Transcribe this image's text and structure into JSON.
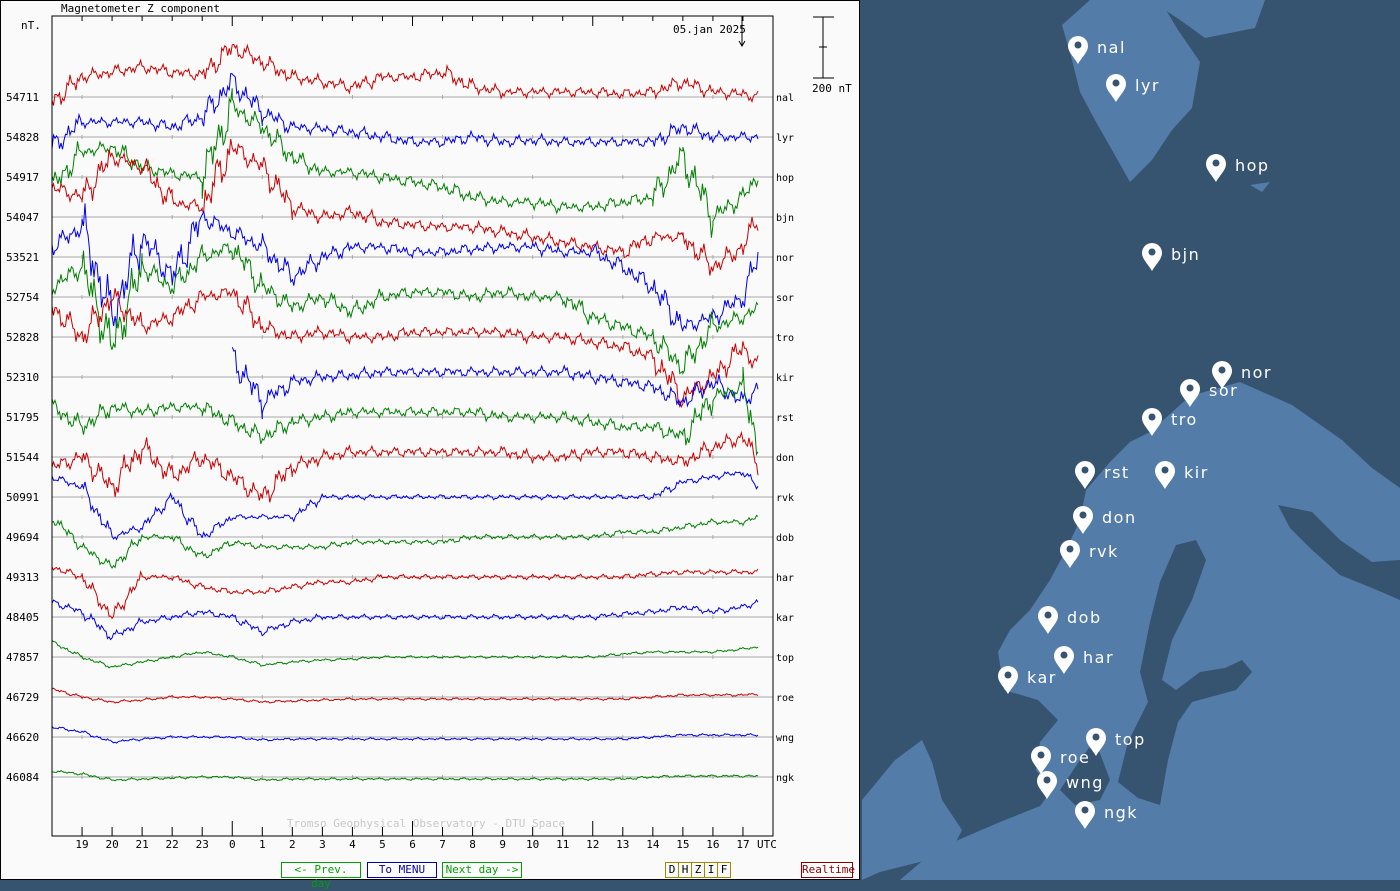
{
  "chart_data": {
    "type": "line",
    "title": "Magnetometer Z component",
    "ylabel": "nT.",
    "date_label": "05.jan 2025",
    "scale_label": "200 nT",
    "scale_nT": 200,
    "watermark": "Tromso Geophysical Observatory - DTU Space",
    "x_unit": "UTC",
    "x_range_hours": [
      18,
      42
    ],
    "x_tick_labels": [
      "19",
      "20",
      "21",
      "22",
      "23",
      "0",
      "1",
      "2",
      "3",
      "4",
      "5",
      "6",
      "7",
      "8",
      "9",
      "10",
      "11",
      "12",
      "13",
      "14",
      "15",
      "16",
      "17"
    ],
    "x": [
      18,
      19,
      20,
      21,
      22,
      23,
      24,
      25,
      26,
      27,
      28,
      29,
      30,
      31,
      32,
      33,
      34,
      35,
      36,
      37,
      38,
      39,
      40,
      41,
      41.5
    ],
    "series": [
      {
        "name": "nal",
        "baseline": "54711",
        "color": "#cc0000",
        "values": [
          -15,
          60,
          75,
          90,
          75,
          66,
          150,
          105,
          60,
          45,
          30,
          60,
          60,
          75,
          30,
          15,
          15,
          15,
          15,
          9,
          15,
          45,
          15,
          9,
          0
        ]
      },
      {
        "name": "lyr",
        "baseline": "54828",
        "color": "#0000ee",
        "values": [
          -30,
          45,
          45,
          45,
          30,
          60,
          165,
          75,
          30,
          24,
          15,
          0,
          -15,
          -15,
          0,
          -15,
          -9,
          -15,
          -15,
          -15,
          -15,
          30,
          0,
          0,
          0
        ]
      },
      {
        "name": "hop",
        "baseline": "54917",
        "color": "#008000",
        "values": [
          -30,
          75,
          90,
          30,
          9,
          0,
          210,
          150,
          60,
          15,
          15,
          0,
          -15,
          -30,
          -60,
          -75,
          -75,
          -90,
          -90,
          -75,
          -60,
          60,
          -120,
          -60,
          0
        ]
      },
      {
        "name": "bjn",
        "baseline": "54047",
        "color": "#cc0000",
        "values": [
          90,
          60,
          180,
          150,
          45,
          30,
          210,
          150,
          30,
          0,
          15,
          -15,
          -24,
          -30,
          -30,
          -45,
          -60,
          -75,
          -90,
          -105,
          -60,
          -60,
          -150,
          -90,
          0
        ]
      },
      {
        "name": "nor",
        "baseline": "53521",
        "color": "#0000ee",
        "values": [
          30,
          90,
          -180,
          60,
          -60,
          120,
          75,
          30,
          -60,
          0,
          30,
          30,
          15,
          15,
          24,
          30,
          30,
          15,
          15,
          -30,
          -90,
          -210,
          -180,
          -120,
          0
        ]
      },
      {
        "name": "sor",
        "baseline": "52754",
        "color": "#008000",
        "values": [
          30,
          90,
          -150,
          90,
          30,
          120,
          150,
          30,
          -30,
          0,
          -45,
          0,
          15,
          15,
          0,
          15,
          0,
          0,
          -60,
          -90,
          -120,
          -210,
          -90,
          -60,
          -30
        ]
      },
      {
        "name": "tro",
        "baseline": "52828",
        "color": "#cc0000",
        "values": [
          90,
          0,
          120,
          30,
          60,
          120,
          135,
          30,
          0,
          15,
          0,
          0,
          15,
          15,
          15,
          15,
          0,
          0,
          -15,
          -30,
          -60,
          -180,
          -120,
          -30,
          -90
        ]
      },
      {
        "name": "kir",
        "baseline": "52310",
        "color": "#0000ee",
        "values": [
          null,
          null,
          null,
          null,
          null,
          null,
          60,
          -75,
          -15,
          0,
          6,
          15,
          15,
          15,
          15,
          15,
          15,
          15,
          0,
          -15,
          -30,
          -75,
          -15,
          -75,
          -30
        ]
      },
      {
        "name": "rst",
        "baseline": "51795",
        "color": "#008000",
        "values": [
          30,
          -30,
          30,
          15,
          30,
          30,
          -15,
          -60,
          -15,
          0,
          15,
          15,
          15,
          15,
          15,
          0,
          0,
          0,
          -15,
          -30,
          -30,
          -60,
          60,
          90,
          -90
        ]
      },
      {
        "name": "don",
        "baseline": "51544",
        "color": "#cc0000",
        "values": [
          -30,
          0,
          -90,
          30,
          -60,
          0,
          -60,
          -120,
          -30,
          0,
          15,
          15,
          15,
          15,
          15,
          15,
          0,
          0,
          15,
          15,
          0,
          -15,
          30,
          60,
          -15
        ]
      },
      {
        "name": "rvk",
        "baseline": "50991",
        "color": "#0000ee",
        "values": [
          60,
          30,
          -120,
          -90,
          0,
          -120,
          -60,
          -60,
          -60,
          0,
          0,
          0,
          0,
          0,
          0,
          0,
          0,
          0,
          0,
          0,
          0,
          45,
          60,
          75,
          30
        ]
      },
      {
        "name": "dob",
        "baseline": "49694",
        "color": "#008000",
        "values": [
          60,
          -30,
          -90,
          0,
          0,
          -60,
          -15,
          -30,
          -30,
          -30,
          -15,
          -15,
          -15,
          -15,
          0,
          0,
          0,
          0,
          0,
          15,
          15,
          30,
          45,
          45,
          60
        ]
      },
      {
        "name": "har",
        "baseline": "49313",
        "color": "#cc0000",
        "values": [
          30,
          0,
          -120,
          0,
          0,
          -30,
          -45,
          -45,
          -30,
          -15,
          -15,
          0,
          0,
          0,
          0,
          0,
          0,
          0,
          0,
          0,
          9,
          15,
          15,
          15,
          15
        ]
      },
      {
        "name": "kar",
        "baseline": "48405",
        "color": "#0000ee",
        "values": [
          45,
          15,
          -60,
          -15,
          0,
          15,
          0,
          -45,
          -15,
          0,
          0,
          0,
          0,
          0,
          0,
          0,
          0,
          0,
          0,
          9,
          15,
          30,
          15,
          30,
          45
        ]
      },
      {
        "name": "top",
        "baseline": "47857",
        "color": "#008000",
        "values": [
          45,
          0,
          -30,
          -15,
          0,
          15,
          0,
          -24,
          -15,
          -9,
          -6,
          0,
          0,
          0,
          0,
          0,
          0,
          0,
          0,
          9,
          15,
          15,
          15,
          24,
          30
        ]
      },
      {
        "name": "roe",
        "baseline": "46729",
        "color": "#cc0000",
        "values": [
          24,
          0,
          -15,
          -9,
          0,
          0,
          -6,
          -15,
          -12,
          -9,
          -6,
          -6,
          -6,
          -6,
          -6,
          -6,
          -6,
          -6,
          -6,
          -6,
          0,
          6,
          6,
          6,
          9
        ]
      },
      {
        "name": "wng",
        "baseline": "46620",
        "color": "#0000ee",
        "values": [
          30,
          15,
          -15,
          -6,
          0,
          0,
          0,
          -9,
          -6,
          -6,
          -6,
          -6,
          -6,
          -6,
          -6,
          -6,
          -6,
          -6,
          -6,
          -6,
          0,
          6,
          6,
          6,
          6
        ]
      },
      {
        "name": "ngk",
        "baseline": "46084",
        "color": "#008000",
        "values": [
          18,
          9,
          -9,
          -6,
          -3,
          0,
          0,
          -9,
          -6,
          -6,
          -6,
          -6,
          -6,
          -6,
          -6,
          -6,
          -6,
          -6,
          -6,
          -6,
          0,
          3,
          3,
          3,
          3
        ]
      }
    ]
  },
  "nav": {
    "prev": "<- Prev. day",
    "menu": "To MENU",
    "next": "Next day ->",
    "components": [
      "D",
      "H",
      "Z",
      "I",
      "F"
    ],
    "realtime": "Realtime"
  },
  "colors": {
    "ocean": "#36536f",
    "land": "#547ca8",
    "prev_next": "#00a000",
    "menu": "#0000aa",
    "realtime": "#880000"
  },
  "map": {
    "stations": [
      "nal",
      "lyr",
      "hop",
      "bjn",
      "nor",
      "sor",
      "tro",
      "rst",
      "kir",
      "don",
      "rvk",
      "dob",
      "har",
      "kar",
      "top",
      "roe",
      "wng",
      "ngk"
    ]
  }
}
